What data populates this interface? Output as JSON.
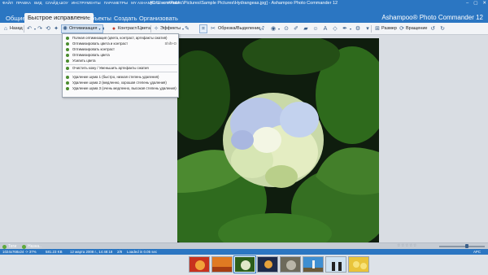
{
  "window": {
    "title": "[C:\\Users\\Public\\Pictures\\Sample Pictures\\Hydrangeas.jpg] - Ashampoo Photo Commander 12",
    "menu": [
      "ФАЙЛ",
      "ПРАВКА",
      "ВИД",
      "СЛАЙД-ШОУ",
      "ИНСТРУМЕНТЫ",
      "ПАРАМЕТРЫ",
      "MY ASHAMPOO",
      "СПРАВКА"
    ],
    "controls": [
      "–",
      "▢",
      "✕"
    ]
  },
  "tabs": [
    {
      "label": "Общие",
      "active": false
    },
    {
      "label": "Быстрое исправление",
      "active": true
    },
    {
      "label": "Объекты",
      "active": false
    },
    {
      "label": "Создать",
      "active": false
    },
    {
      "label": "Организовать",
      "active": false
    }
  ],
  "brand": "Ashampoo® Photo Commander 12",
  "toolbar": {
    "back_label": "Назад",
    "optimize_label": "Оптимизация",
    "contrast_label": "Контраст/Цвета",
    "effects_label": "Эффекты",
    "crop_label": "Обрезка/Выделение",
    "resize_label": "Размер",
    "rotate_label": "Вращение"
  },
  "dropdown": {
    "items": [
      {
        "label": "Полная оптимизация (цвета, контраст, артефакты сжатия)",
        "shortcut": ""
      },
      {
        "label": "Оптимизировать цвета и контраст",
        "shortcut": "Shift+O"
      },
      {
        "label": "Оптимизировать контраст",
        "shortcut": ""
      },
      {
        "label": "Оптимизировать цвета",
        "shortcut": ""
      },
      {
        "label": "Усилить цвета",
        "shortcut": ""
      },
      {
        "label": "Очистить кожу / Уменьшить артефакты сжатия",
        "shortcut": ""
      },
      {
        "label": "Удаление шума 1 (быстро, низкая степень удаления)",
        "shortcut": ""
      },
      {
        "label": "Удаление шума 2 (медленно, хорошая степень удаления)",
        "shortcut": ""
      },
      {
        "label": "Удаление шума 3 (очень медленно, высокая степень удаления)",
        "shortcut": ""
      }
    ]
  },
  "tags": [
    {
      "label": "Теги"
    },
    {
      "label": "Назна.."
    }
  ],
  "stars": "☆☆☆☆☆",
  "status": {
    "dimensions": "1024x768x24 -> 37%",
    "filesize": "581.23 KB",
    "date": "12 марта 2008 г., 14:48:18",
    "index": "2/8",
    "loaded": "Loaded in 0.05 sec",
    "kbd": "APC"
  },
  "colors": {
    "accent": "#2b76c2",
    "toolbar_bg": "#f2f4f7",
    "workspace_bg": "#d9dde3"
  },
  "filmstrip": {
    "thumbnails": [
      {
        "name": "thumb-flowers"
      },
      {
        "name": "thumb-desert"
      },
      {
        "name": "thumb-hydrangeas",
        "selected": true
      },
      {
        "name": "thumb-jellyfish"
      },
      {
        "name": "thumb-koala"
      },
      {
        "name": "thumb-lighthouse"
      },
      {
        "name": "thumb-penguins"
      },
      {
        "name": "thumb-tulips"
      }
    ]
  }
}
